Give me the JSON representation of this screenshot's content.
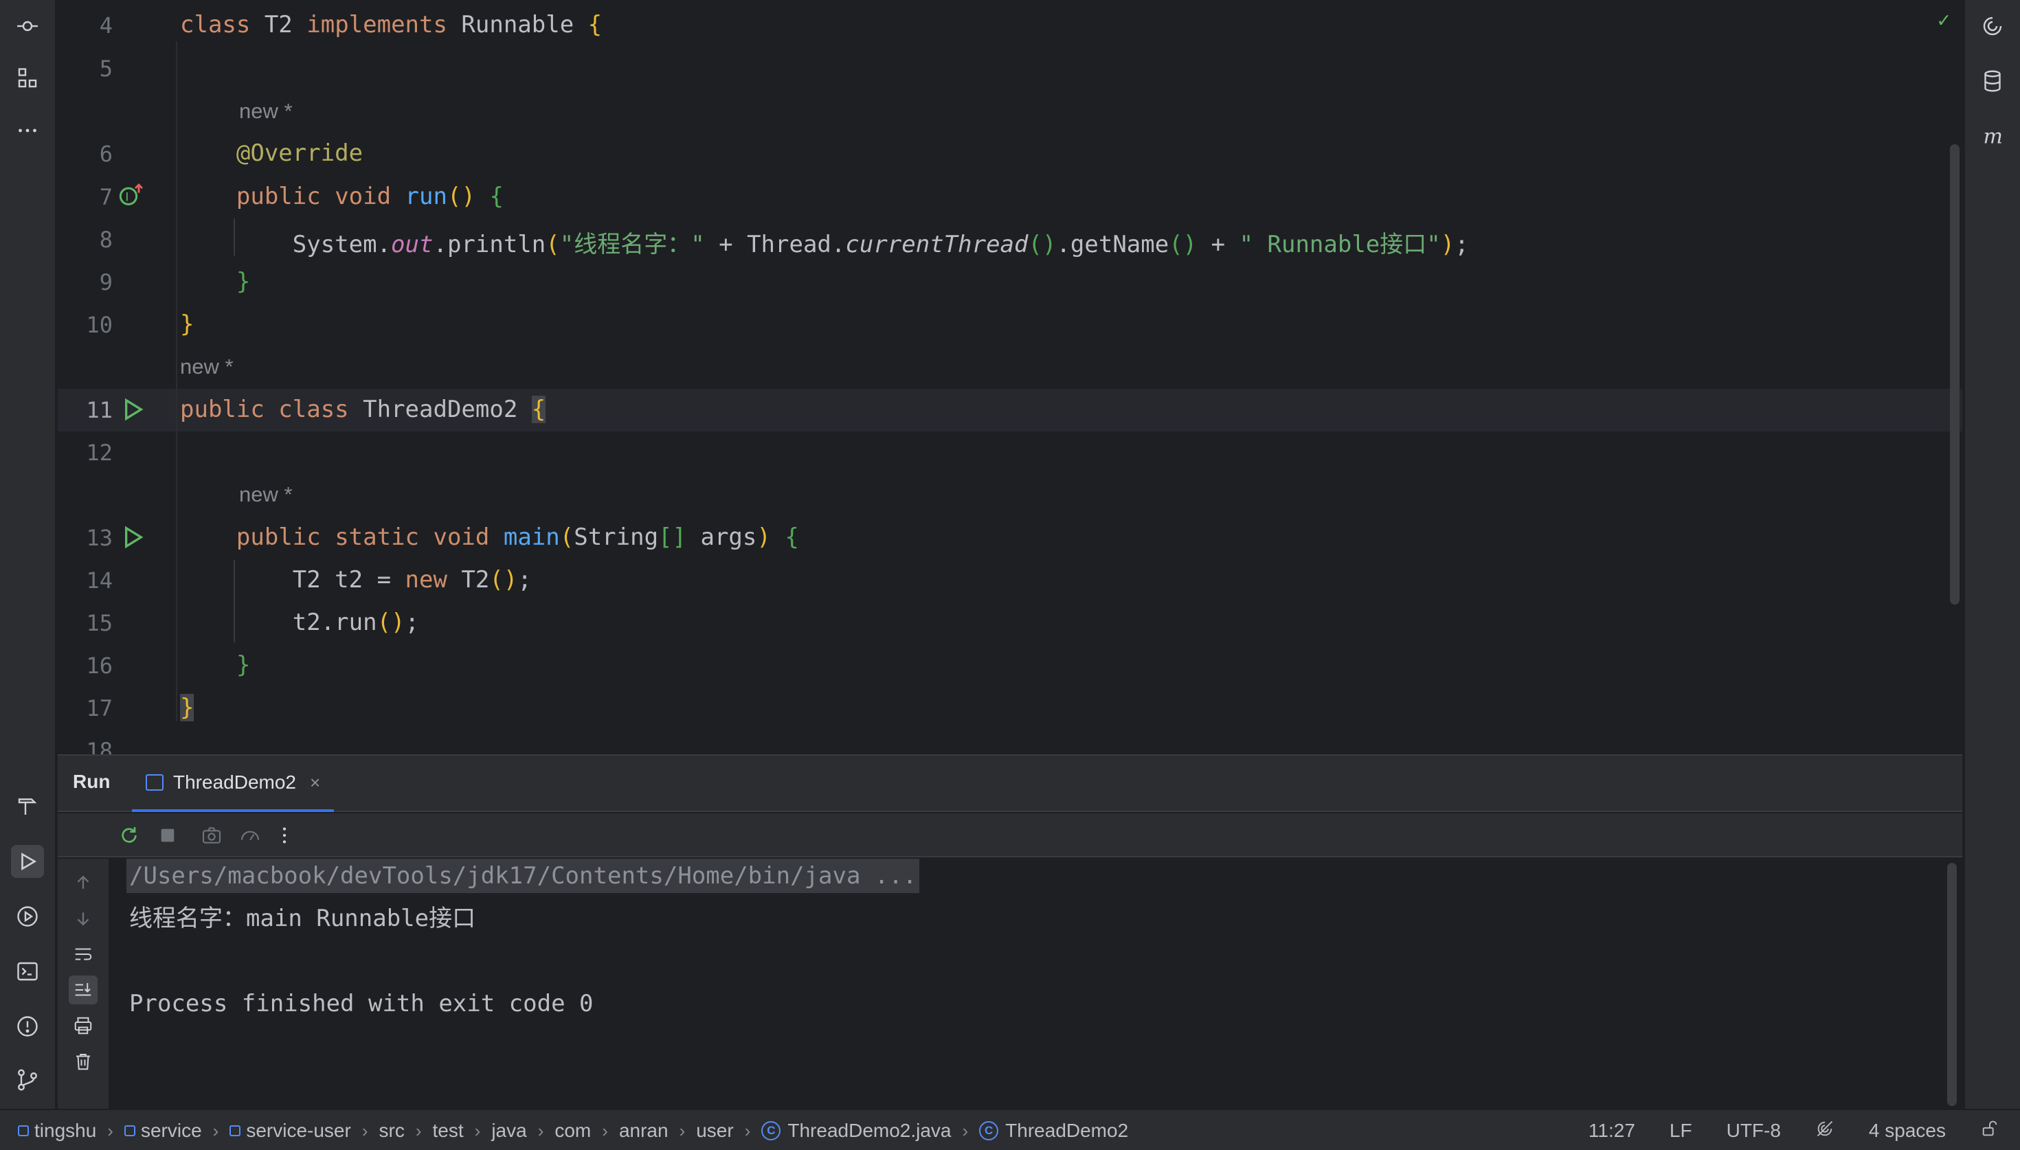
{
  "editor": {
    "lines": [
      {
        "num": "4",
        "tokens": [
          {
            "t": "class ",
            "c": "kw"
          },
          {
            "t": "T2 ",
            "c": ""
          },
          {
            "t": "implements ",
            "c": "kw"
          },
          {
            "t": "Runnable ",
            "c": ""
          },
          {
            "t": "{",
            "c": "b1"
          }
        ]
      },
      {
        "num": "5",
        "tokens": []
      },
      {
        "num": "6",
        "tokens": [
          {
            "t": "    ",
            "c": ""
          },
          {
            "t": "@Override",
            "c": "ann"
          }
        ]
      },
      {
        "num": "7",
        "tokens": [
          {
            "t": "    ",
            "c": ""
          },
          {
            "t": "public ",
            "c": "kw"
          },
          {
            "t": "void ",
            "c": "kw"
          },
          {
            "t": "run",
            "c": "fn"
          },
          {
            "t": "() ",
            "c": "b1"
          },
          {
            "t": "{",
            "c": "b2"
          }
        ]
      },
      {
        "num": "8",
        "tokens": [
          {
            "t": "        System.",
            "c": ""
          },
          {
            "t": "out",
            "c": "stat"
          },
          {
            "t": ".println",
            "c": ""
          },
          {
            "t": "(",
            "c": "b1"
          },
          {
            "t": "\"线程名字：\"",
            "c": "str"
          },
          {
            "t": " + Thread.",
            "c": ""
          },
          {
            "t": "currentThread",
            "c": "it"
          },
          {
            "t": "()",
            "c": "b2"
          },
          {
            "t": ".getName",
            "c": ""
          },
          {
            "t": "()",
            "c": "b2"
          },
          {
            "t": " + ",
            "c": ""
          },
          {
            "t": "\" Runnable接口\"",
            "c": "str"
          },
          {
            "t": ")",
            "c": "b1"
          },
          {
            "t": ";",
            "c": ""
          }
        ]
      },
      {
        "num": "9",
        "tokens": [
          {
            "t": "    ",
            "c": ""
          },
          {
            "t": "}",
            "c": "b2"
          }
        ]
      },
      {
        "num": "10",
        "tokens": [
          {
            "t": "}",
            "c": "b1"
          }
        ]
      },
      {
        "num": "11",
        "tokens": [
          {
            "t": "public ",
            "c": "kw"
          },
          {
            "t": "class ",
            "c": "kw"
          },
          {
            "t": "ThreadDemo2 ",
            "c": ""
          },
          {
            "t": "{",
            "c": "b1 bmatch"
          }
        ]
      },
      {
        "num": "12",
        "tokens": []
      },
      {
        "num": "13",
        "tokens": [
          {
            "t": "    ",
            "c": ""
          },
          {
            "t": "public ",
            "c": "kw"
          },
          {
            "t": "static ",
            "c": "kw"
          },
          {
            "t": "void ",
            "c": "kw"
          },
          {
            "t": "main",
            "c": "fn"
          },
          {
            "t": "(",
            "c": "b1"
          },
          {
            "t": "String",
            "c": ""
          },
          {
            "t": "[]",
            "c": "b2"
          },
          {
            "t": " args",
            "c": ""
          },
          {
            "t": ") ",
            "c": "b1"
          },
          {
            "t": "{",
            "c": "b2"
          }
        ]
      },
      {
        "num": "14",
        "tokens": [
          {
            "t": "        T2 t2 = ",
            "c": ""
          },
          {
            "t": "new ",
            "c": "kw"
          },
          {
            "t": "T2",
            "c": ""
          },
          {
            "t": "()",
            "c": "b1"
          },
          {
            "t": ";",
            "c": ""
          }
        ]
      },
      {
        "num": "15",
        "tokens": [
          {
            "t": "        t2.run",
            "c": ""
          },
          {
            "t": "()",
            "c": "b1"
          },
          {
            "t": ";",
            "c": ""
          }
        ]
      },
      {
        "num": "16",
        "tokens": [
          {
            "t": "    ",
            "c": ""
          },
          {
            "t": "}",
            "c": "b2"
          }
        ]
      },
      {
        "num": "17",
        "tokens": [
          {
            "t": "}",
            "c": "b1 bmatch"
          }
        ]
      },
      {
        "num": "18",
        "tokens": []
      }
    ],
    "hint": "new *"
  },
  "run_panel": {
    "title": "Run",
    "tab_label": "ThreadDemo2",
    "tab_close": "×",
    "console": [
      "/Users/macbook/devTools/jdk17/Contents/Home/bin/java ...",
      "线程名字：main Runnable接口",
      "",
      "Process finished with exit code 0"
    ]
  },
  "status_bar": {
    "crumbs": [
      {
        "label": "tingshu",
        "icon": "module"
      },
      {
        "label": "service",
        "icon": "module"
      },
      {
        "label": "service-user",
        "icon": "module"
      },
      {
        "label": "src",
        "icon": ""
      },
      {
        "label": "test",
        "icon": ""
      },
      {
        "label": "java",
        "icon": ""
      },
      {
        "label": "com",
        "icon": ""
      },
      {
        "label": "anran",
        "icon": ""
      },
      {
        "label": "user",
        "icon": ""
      },
      {
        "label": "ThreadDemo2.java",
        "icon": "class"
      },
      {
        "label": "ThreadDemo2",
        "icon": "class"
      }
    ],
    "position": "11:27",
    "line_ending": "LF",
    "encoding": "UTF-8",
    "indent": "4 spaces"
  },
  "colors": {
    "keyword": "#cf8e6d",
    "function": "#56a8f5",
    "string": "#6aab73",
    "annotation": "#b3ae60",
    "accent": "#3574f0",
    "run_green": "#5fb865"
  }
}
